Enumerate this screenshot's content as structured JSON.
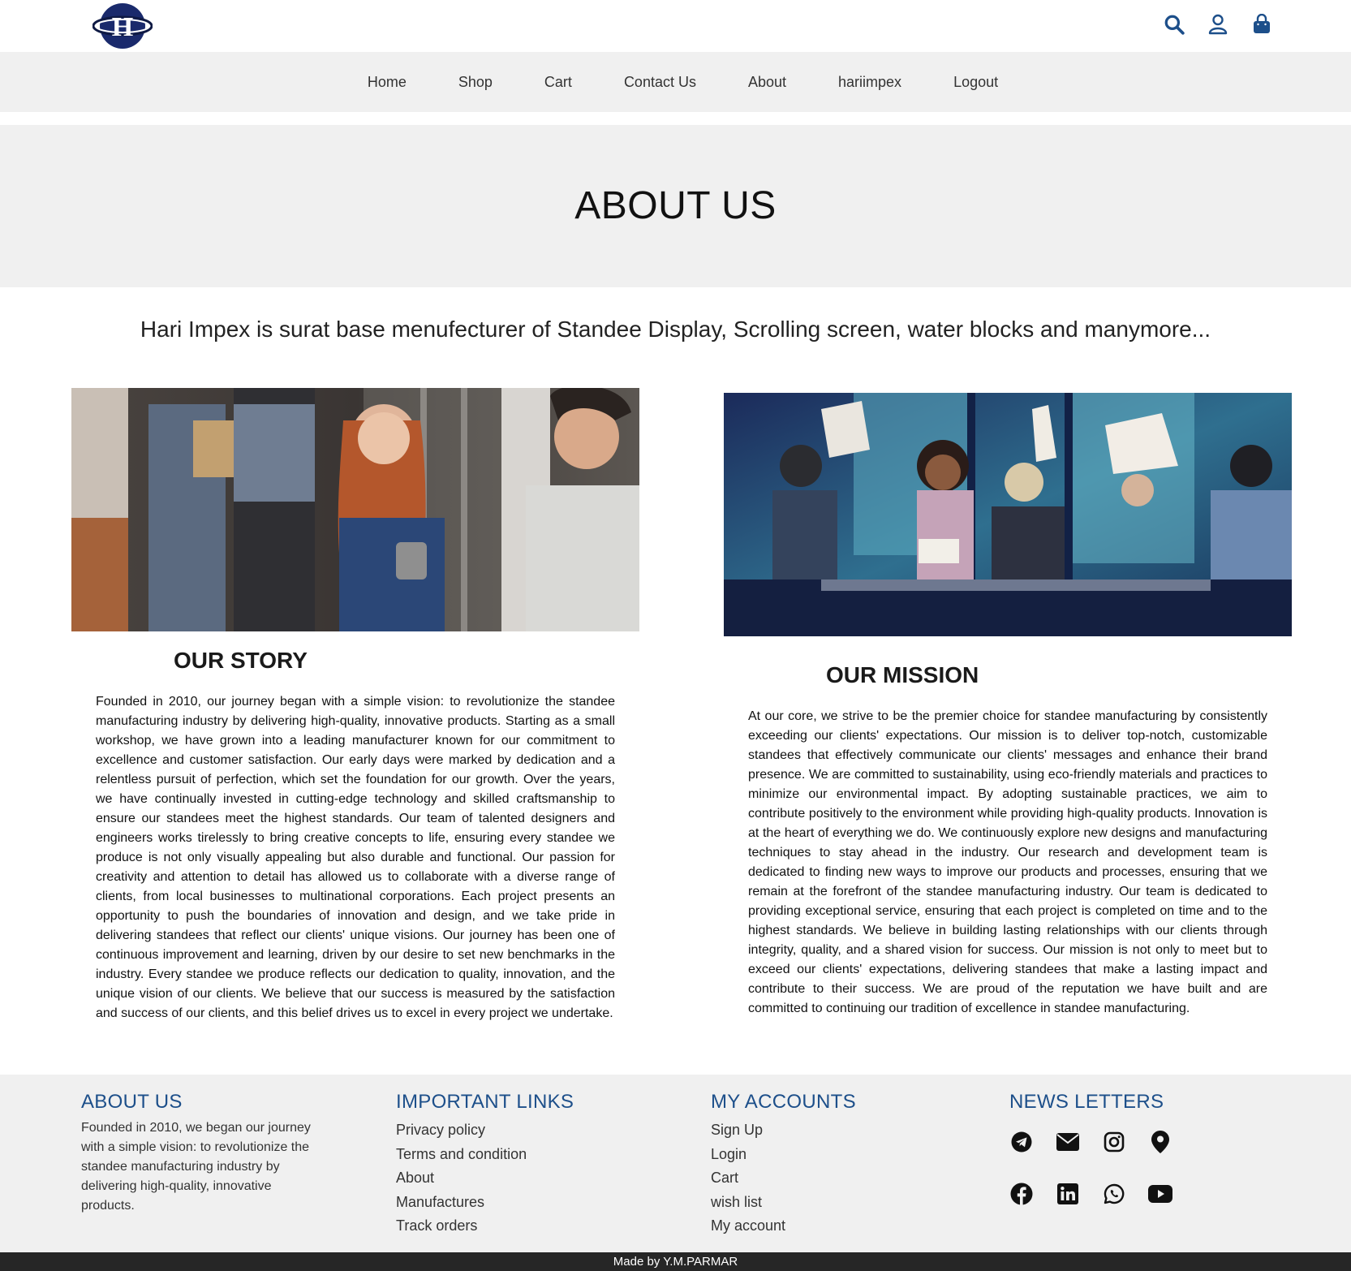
{
  "header": {
    "logo_letter": "H",
    "icons": [
      "search-icon",
      "user-icon",
      "shopping-bag-icon"
    ],
    "accent_color": "#1d4f8a"
  },
  "nav": {
    "items": [
      {
        "label": "Home"
      },
      {
        "label": "Shop"
      },
      {
        "label": "Cart"
      },
      {
        "label": "Contact Us"
      },
      {
        "label": "About"
      },
      {
        "label": "hariimpex"
      },
      {
        "label": "Logout"
      }
    ]
  },
  "hero": {
    "title": "ABOUT US"
  },
  "tagline": "Hari Impex is surat base menufecturer of Standee Display, Scrolling screen, water blocks and manymore...",
  "story": {
    "title": "OUR STORY",
    "text": "Founded in 2010, our journey began with a simple vision: to revolutionize the standee manufacturing industry by delivering high-quality, innovative products. Starting as a small workshop, we have grown into a leading manufacturer known for our commitment to excellence and customer satisfaction. Our early days were marked by dedication and a relentless pursuit of perfection, which set the foundation for our growth. Over the years, we have continually invested in cutting-edge technology and skilled craftsmanship to ensure our standees meet the highest standards. Our team of talented designers and engineers works tirelessly to bring creative concepts to life, ensuring every standee we produce is not only visually appealing but also durable and functional. Our passion for creativity and attention to detail has allowed us to collaborate with a diverse range of clients, from local businesses to multinational corporations. Each project presents an opportunity to push the boundaries of innovation and design, and we take pride in delivering standees that reflect our clients' unique visions. Our journey has been one of continuous improvement and learning, driven by our desire to set new benchmarks in the industry. Every standee we produce reflects our dedication to quality, innovation, and the unique vision of our clients. We believe that our success is measured by the satisfaction and success of our clients, and this belief drives us to excel in every project we undertake."
  },
  "mission": {
    "title": "OUR MISSION",
    "text": "At our core, we strive to be the premier choice for standee manufacturing by consistently exceeding our clients' expectations. Our mission is to deliver top-notch, customizable standees that effectively communicate our clients' messages and enhance their brand presence. We are committed to sustainability, using eco-friendly materials and practices to minimize our environmental impact. By adopting sustainable practices, we aim to contribute positively to the environment while providing high-quality products. Innovation is at the heart of everything we do. We continuously explore new designs and manufacturing techniques to stay ahead in the industry. Our research and development team is dedicated to finding new ways to improve our products and processes, ensuring that we remain at the forefront of the standee manufacturing industry. Our team is dedicated to providing exceptional service, ensuring that each project is completed on time and to the highest standards. We believe in building lasting relationships with our clients through integrity, quality, and a shared vision for success. Our mission is not only to meet but to exceed our clients' expectations, delivering standees that make a lasting impact and contribute to their success. We are proud of the reputation we have built and are committed to continuing our tradition of excellence in standee manufacturing."
  },
  "footer": {
    "about": {
      "title": "ABOUT US",
      "text": "Founded in 2010, we began our journey with a simple vision: to revolutionize the standee manufacturing industry by delivering high-quality, innovative products."
    },
    "links": {
      "title": "IMPORTANT LINKS",
      "items": [
        "Privacy policy",
        "Terms and condition",
        "About",
        "Manufactures",
        "Track orders"
      ]
    },
    "accounts": {
      "title": "MY ACCOUNTS",
      "items": [
        "Sign Up",
        "Login",
        "Cart",
        "wish list",
        "My account"
      ]
    },
    "news": {
      "title": "NEWS LETTERS",
      "icons": [
        "telegram-icon",
        "envelope-icon",
        "instagram-icon",
        "location-pin-icon",
        "facebook-icon",
        "linkedin-icon",
        "whatsapp-icon",
        "youtube-icon"
      ]
    },
    "credit": "Made by Y.M.PARMAR"
  }
}
